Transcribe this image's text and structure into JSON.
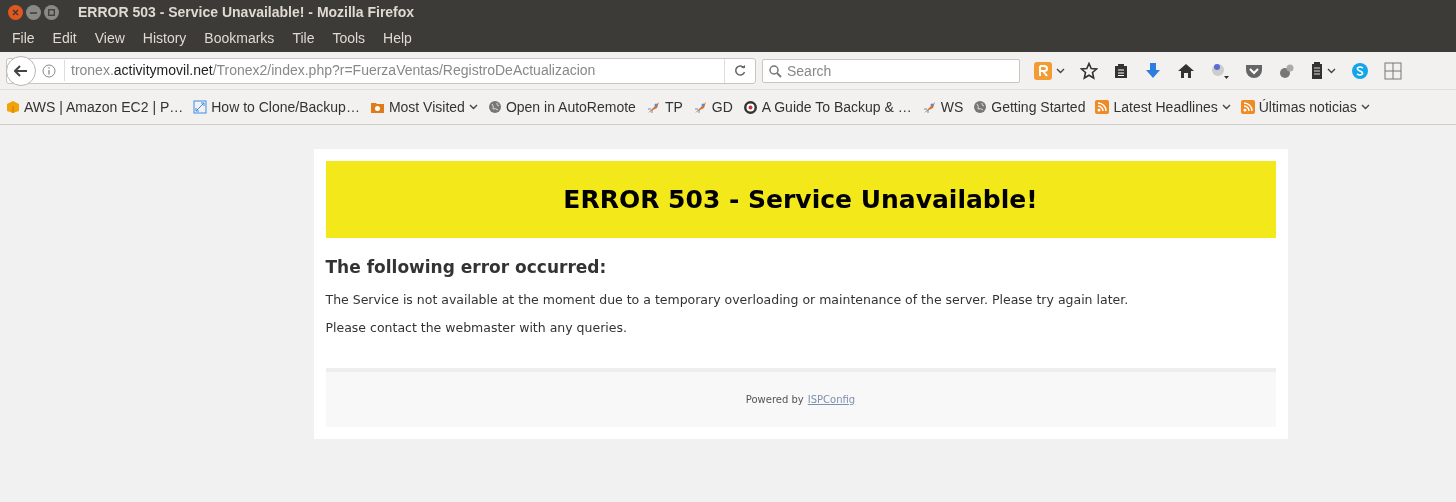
{
  "window": {
    "title": "ERROR 503 - Service Unavailable! - Mozilla Firefox"
  },
  "menu": [
    "File",
    "Edit",
    "View",
    "History",
    "Bookmarks",
    "Tile",
    "Tools",
    "Help"
  ],
  "url": {
    "host_prefix": "tronex.",
    "domain": "activitymovil.net",
    "path": "/Tronex2/index.php?r=FuerzaVentas/RegistroDeActualizacion"
  },
  "search": {
    "placeholder": "Search"
  },
  "bookmarks": [
    {
      "label": "AWS | Amazon EC2 | P…",
      "kind": "box",
      "has_menu": false
    },
    {
      "label": "How to Clone/Backup…",
      "kind": "link",
      "has_menu": false
    },
    {
      "label": "Most Visited",
      "kind": "folder",
      "has_menu": true
    },
    {
      "label": "Open in AutoRemote",
      "kind": "globe",
      "has_menu": false
    },
    {
      "label": "TP",
      "kind": "tool",
      "has_menu": false
    },
    {
      "label": "GD",
      "kind": "tool",
      "has_menu": false
    },
    {
      "label": "A Guide To Backup & …",
      "kind": "disc",
      "has_menu": false
    },
    {
      "label": "WS",
      "kind": "tool",
      "has_menu": false
    },
    {
      "label": "Getting Started",
      "kind": "globe",
      "has_menu": false
    },
    {
      "label": "Latest Headlines",
      "kind": "rss",
      "has_menu": true
    },
    {
      "label": "Últimas noticias",
      "kind": "rss",
      "has_menu": true
    }
  ],
  "page": {
    "heading": "ERROR 503 - Service Unavailable!",
    "subheading": "The following error occurred:",
    "paragraphs": [
      "The Service is not available at the moment due to a temporary overloading or maintenance of the server. Please try again later.",
      "Please contact the webmaster with any queries."
    ],
    "footer": {
      "text": "Powered by",
      "link": "ISPConfig"
    }
  }
}
